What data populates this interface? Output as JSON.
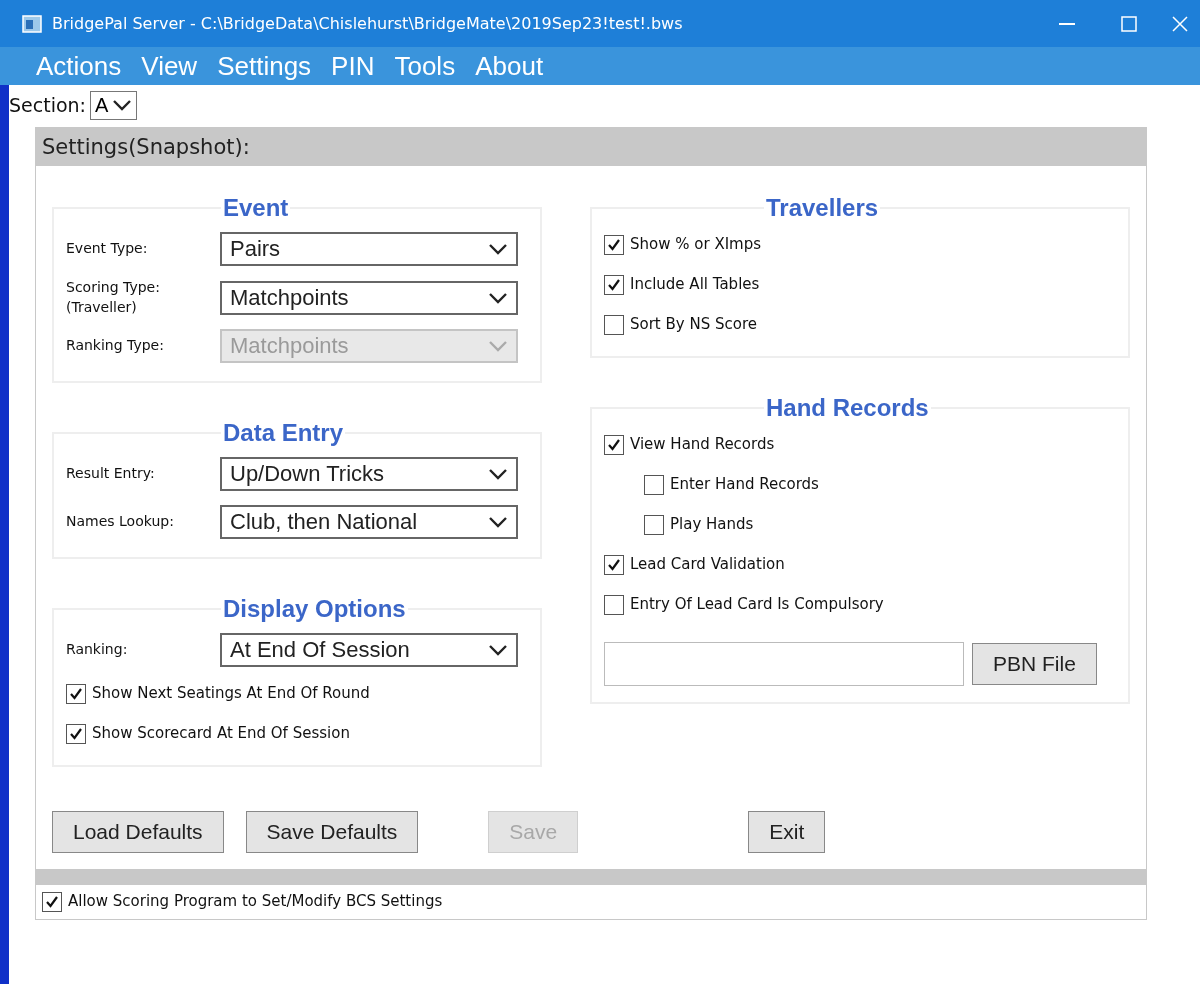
{
  "window": {
    "title": "BridgePal Server - C:\\BridgeData\\Chislehurst\\BridgeMate\\2019Sep23!test!.bws"
  },
  "menu": [
    "Actions",
    "View",
    "Settings",
    "PIN",
    "Tools",
    "About"
  ],
  "section": {
    "label": "Section:",
    "value": "A"
  },
  "panel_title": "Settings(Snapshot):",
  "left_groups": [
    {
      "title": "Event",
      "rows": [
        {
          "kind": "select",
          "label": "Event Type:",
          "value": "Pairs",
          "disabled": false
        },
        {
          "kind": "select",
          "label": "Scoring Type:\n(Traveller)",
          "value": "Matchpoints",
          "disabled": false
        },
        {
          "kind": "select",
          "label": "Ranking Type:",
          "value": "Matchpoints",
          "disabled": true
        }
      ]
    },
    {
      "title": "Data Entry",
      "rows": [
        {
          "kind": "select",
          "label": "Result Entry:",
          "value": "Up/Down Tricks",
          "disabled": false
        },
        {
          "kind": "select",
          "label": "Names Lookup:",
          "value": "Club, then National",
          "disabled": false
        }
      ]
    },
    {
      "title": "Display Options",
      "rows": [
        {
          "kind": "select",
          "label": "Ranking:",
          "value": "At End Of Session",
          "disabled": false
        },
        {
          "kind": "checkbox",
          "label": "Show Next Seatings At End Of Round",
          "checked": true
        },
        {
          "kind": "checkbox",
          "label": "Show Scorecard At End Of Session",
          "checked": true
        }
      ]
    }
  ],
  "right_groups": [
    {
      "title": "Travellers",
      "rows": [
        {
          "kind": "checkbox",
          "label": "Show % or XImps",
          "checked": true
        },
        {
          "kind": "checkbox",
          "label": "Include All Tables",
          "checked": true
        },
        {
          "kind": "checkbox",
          "label": "Sort By NS Score",
          "checked": false
        }
      ]
    },
    {
      "title": "Hand Records",
      "rows": [
        {
          "kind": "checkbox",
          "label": "View Hand Records",
          "checked": true,
          "children": [
            {
              "kind": "checkbox",
              "label": "Enter Hand Records",
              "checked": false
            },
            {
              "kind": "checkbox",
              "label": "Play Hands",
              "checked": false
            }
          ]
        },
        {
          "kind": "checkbox",
          "label": "Lead Card Validation",
          "checked": true
        },
        {
          "kind": "checkbox",
          "label": "Entry Of Lead Card Is Compulsory",
          "checked": false
        },
        {
          "kind": "file",
          "button": "PBN File"
        }
      ]
    }
  ],
  "buttons": [
    {
      "label": "Load Defaults",
      "disabled": false
    },
    {
      "label": "Save Defaults",
      "disabled": false
    },
    {
      "label": "Save",
      "disabled": true
    },
    {
      "label": "Exit",
      "disabled": false
    }
  ],
  "footer_checkbox": {
    "label": "Allow Scoring Program to Set/Modify BCS Settings",
    "checked": true
  }
}
